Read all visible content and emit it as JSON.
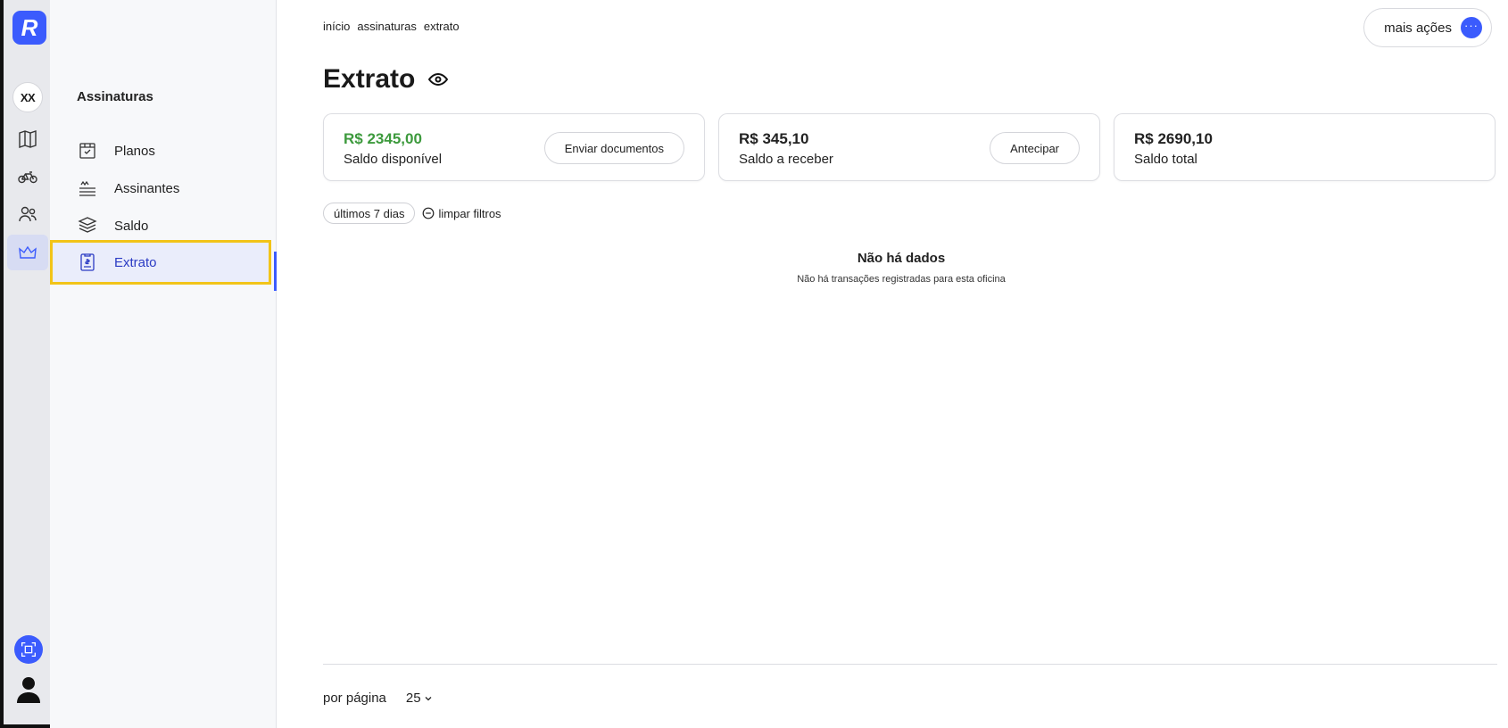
{
  "rail": {
    "logo_letter": "R",
    "org_initials": "XX",
    "icons": [
      "map-icon",
      "bike-icon",
      "users-icon",
      "crown-icon"
    ],
    "active_icon": "crown-icon"
  },
  "subnav": {
    "title": "Assinaturas",
    "items": [
      {
        "label": "Planos",
        "icon": "plan-icon"
      },
      {
        "label": "Assinantes",
        "icon": "subscribers-icon"
      },
      {
        "label": "Saldo",
        "icon": "balance-icon"
      },
      {
        "label": "Extrato",
        "icon": "statement-icon",
        "active": true
      }
    ]
  },
  "header": {
    "breadcrumb": [
      "início",
      "assinaturas",
      "extrato"
    ],
    "more_actions_label": "mais ações",
    "more_actions_dots": "···",
    "title": "Extrato"
  },
  "cards": [
    {
      "value": "R$ 2345,00",
      "label": "Saldo disponível",
      "button": "Enviar documentos",
      "value_color": "#3d9a3d"
    },
    {
      "value": "R$ 345,10",
      "label": "Saldo a receber",
      "button": "Antecipar"
    },
    {
      "value": "R$ 2690,10",
      "label": "Saldo total"
    }
  ],
  "filters": {
    "period": "últimos 7 dias",
    "clear_label": "limpar filtros"
  },
  "empty_state": {
    "title": "Não há dados",
    "subtitle": "Não há transações registradas para esta oficina"
  },
  "pagination": {
    "per_page_label": "por página",
    "per_page_value": "25"
  },
  "colors": {
    "accent": "#3b5bfd",
    "highlight_border": "#f2c418",
    "positive": "#3d9a3d"
  }
}
